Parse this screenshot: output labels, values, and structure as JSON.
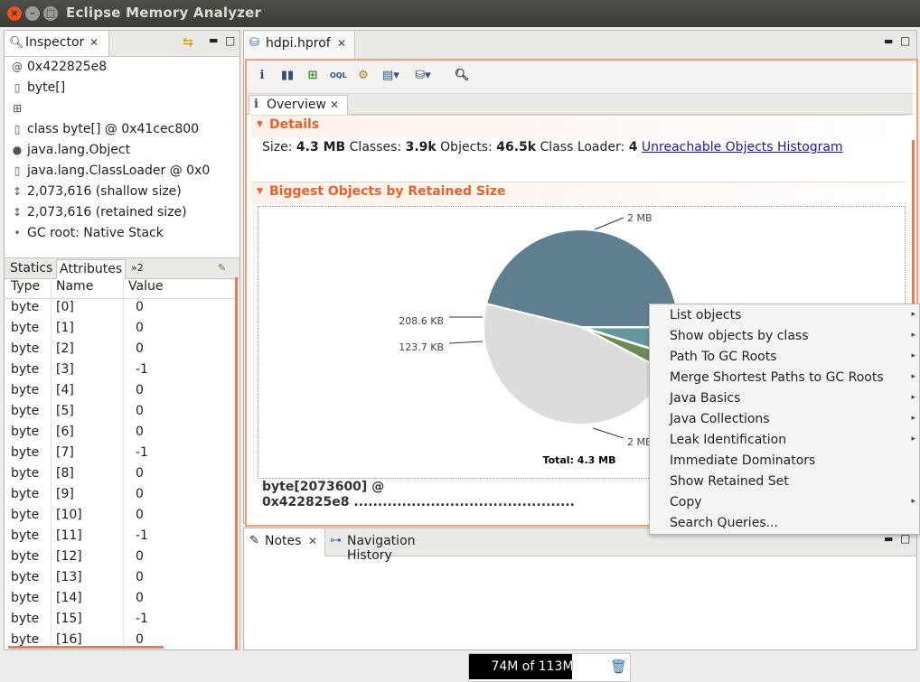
{
  "window": {
    "title": "Eclipse Memory Analyzer",
    "close_glyph": "×",
    "min_glyph": "–",
    "max_glyph": "□"
  },
  "inspector": {
    "tab_label": "Inspector",
    "rows": [
      {
        "icon": "at-icon",
        "glyph": "@",
        "text": "0x422825e8"
      },
      {
        "icon": "class-icon",
        "glyph": "▯",
        "text": "byte[]"
      },
      {
        "icon": "package-icon",
        "glyph": "⊞",
        "text": ""
      },
      {
        "icon": "class-icon",
        "glyph": "▯",
        "text": "class byte[] @ 0x41cec800"
      },
      {
        "icon": "superclass-icon",
        "glyph": "●",
        "text": "java.lang.Object"
      },
      {
        "icon": "classloader-icon",
        "glyph": "▯",
        "text": "java.lang.ClassLoader @ 0x0"
      },
      {
        "icon": "size-icon",
        "glyph": "↕",
        "text": "2,073,616 (shallow size)"
      },
      {
        "icon": "size-icon",
        "glyph": "↕",
        "text": "2,073,616 (retained size)"
      },
      {
        "icon": "gcroot-icon",
        "glyph": "•",
        "text": "GC root: Native Stack"
      }
    ],
    "attr_tabs": [
      "Statics",
      "Attributes",
      "»2"
    ],
    "columns": [
      "Type",
      "Name",
      "Value"
    ],
    "attributes": [
      [
        "byte",
        "[0]",
        "0"
      ],
      [
        "byte",
        "[1]",
        "0"
      ],
      [
        "byte",
        "[2]",
        "0"
      ],
      [
        "byte",
        "[3]",
        "-1"
      ],
      [
        "byte",
        "[4]",
        "0"
      ],
      [
        "byte",
        "[5]",
        "0"
      ],
      [
        "byte",
        "[6]",
        "0"
      ],
      [
        "byte",
        "[7]",
        "-1"
      ],
      [
        "byte",
        "[8]",
        "0"
      ],
      [
        "byte",
        "[9]",
        "0"
      ],
      [
        "byte",
        "[10]",
        "0"
      ],
      [
        "byte",
        "[11]",
        "-1"
      ],
      [
        "byte",
        "[12]",
        "0"
      ],
      [
        "byte",
        "[13]",
        "0"
      ],
      [
        "byte",
        "[14]",
        "0"
      ],
      [
        "byte",
        "[15]",
        "-1"
      ],
      [
        "byte",
        "[16]",
        "0"
      ]
    ]
  },
  "editor": {
    "tab_label": "hdpi.hprof",
    "overview_tab": "Overview",
    "details": {
      "heading": "Details",
      "size_label": "Size:",
      "size": "4.3 MB",
      "classes_label": "Classes:",
      "classes": "3.9k",
      "objects_label": "Objects:",
      "objects": "46.5k",
      "loader_label": "Class Loader:",
      "loader": "4",
      "link": "Unreachable Objects Histogram"
    },
    "biggest": {
      "heading": "Biggest Objects by Retained Size",
      "selected_line1": "byte[2073600] @",
      "selected_line2": "0x422825e8 .............................................."
    }
  },
  "chart_data": {
    "type": "pie",
    "slices": [
      {
        "label": "2 MB",
        "value": 2.0,
        "color": "#5f7f90"
      },
      {
        "label": "208.6 KB",
        "value": 0.2086,
        "color": "#62989a"
      },
      {
        "label": "123.7 KB",
        "value": 0.1237,
        "color": "#6e8a55"
      },
      {
        "label": "2 MB",
        "value": 2.0,
        "color": "#dcdcdc"
      }
    ],
    "total_label": "Total: 4.3 MB"
  },
  "bottom": {
    "notes_tab": "Notes",
    "history_tab": "Navigation History"
  },
  "context_menu": {
    "items": [
      {
        "label": "List objects",
        "submenu": true
      },
      {
        "label": "Show objects by class",
        "submenu": true
      },
      {
        "label": "Path To GC Roots",
        "submenu": true
      },
      {
        "label": "Merge Shortest Paths to GC Roots",
        "submenu": true
      },
      {
        "label": "Java Basics",
        "submenu": true
      },
      {
        "label": "Java Collections",
        "submenu": true
      },
      {
        "label": "Leak Identification",
        "submenu": true
      },
      {
        "label": "Immediate Dominators",
        "submenu": false
      },
      {
        "label": "Show Retained Set",
        "submenu": false
      },
      {
        "label": "Copy",
        "submenu": true
      },
      {
        "label": "Search Queries...",
        "submenu": false
      }
    ]
  },
  "status": {
    "heap": "74M of 113M",
    "heap_used_fraction": 0.65
  }
}
